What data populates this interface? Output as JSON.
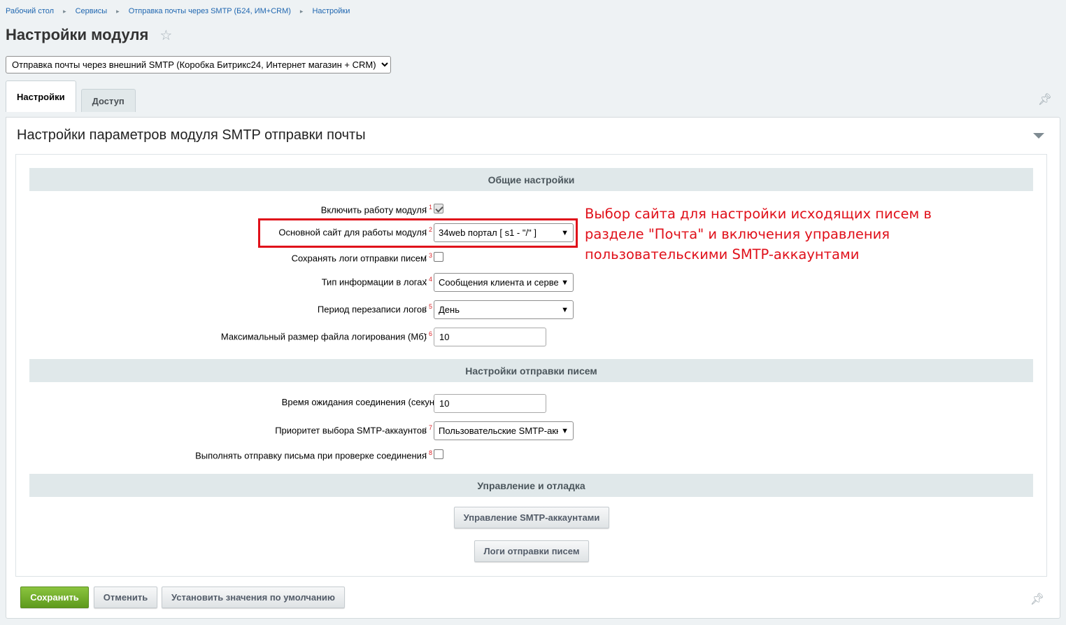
{
  "breadcrumbs": [
    "Рабочий стол",
    "Сервисы",
    "Отправка почты через SMTP (Б24, ИМ+CRM)",
    "Настройки"
  ],
  "page_title": "Настройки модуля",
  "module_select": {
    "value": "Отправка почты через внешний SMTP (Коробка Битрикс24, Интернет магазин + CRM)"
  },
  "tabs": [
    {
      "label": "Настройки",
      "active": true
    },
    {
      "label": "Доступ",
      "active": false
    }
  ],
  "panel_title": "Настройки параметров модуля SMTP отправки почты",
  "sections": {
    "general": "Общие настройки",
    "sending": "Настройки отправки писем",
    "management": "Управление и отладка"
  },
  "fields": {
    "enable": {
      "label": "Включить работу модуля",
      "note": "1",
      "checked": true
    },
    "main_site": {
      "label": "Основной сайт для работы модуля",
      "note": "2",
      "value": "34web портал [ s1 - \"/\" ]"
    },
    "save_logs": {
      "label": "Сохранять логи отправки писем",
      "note": "3",
      "checked": false
    },
    "log_info_type": {
      "label": "Тип информации в логах",
      "note": "4",
      "value": "Сообщения клиента и серве"
    },
    "log_period": {
      "label": "Период перезаписи логов",
      "note": "5",
      "value": "День"
    },
    "log_max_size": {
      "label": "Максимальный размер файла логирования (Мб)",
      "note": "6",
      "value": "10"
    },
    "timeout": {
      "label": "Время ожидания соединения (секунд)",
      "value": "10"
    },
    "smtp_priority": {
      "label": "Приоритет выбора SMTP-аккаунтов",
      "note": "7",
      "value": "Пользовательские SMTP-акк"
    },
    "send_on_check": {
      "label": "Выполнять отправку письма при проверке соединения",
      "note": "8",
      "checked": false
    }
  },
  "colon": ":",
  "annotation": "Выбор сайта для настройки исходящих писем в разделе \"Почта\" и включения управления пользовательскими SMTP-аккаунтами",
  "buttons": {
    "manage_smtp": "Управление SMTP-аккаунтами",
    "send_logs": "Логи отправки писем",
    "save": "Сохранить",
    "cancel": "Отменить",
    "defaults": "Установить значения по умолчанию"
  },
  "colors": {
    "accent": "#2067b0",
    "save_green": "#6fab2a",
    "annotation_red": "#e0101a"
  }
}
